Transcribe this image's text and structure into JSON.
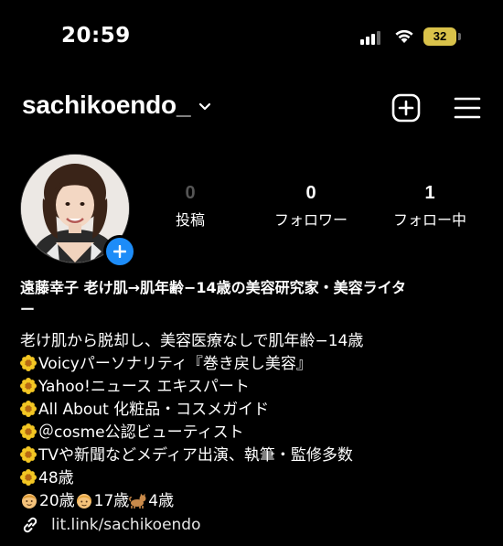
{
  "status_bar": {
    "time": "20:59",
    "battery": "32"
  },
  "header": {
    "username": "sachikoendo_"
  },
  "stats": [
    {
      "value": "0",
      "label": "投稿"
    },
    {
      "value": "0",
      "label": "フォロワー"
    },
    {
      "value": "1",
      "label": "フォロー中"
    }
  ],
  "bio": {
    "name_line1": "遠藤幸子 老け肌→肌年齢−14歳の美容研究家・美容ライタ",
    "name_line2": "ー",
    "line1": "老け肌から脱却し、美容医療なしで肌年齢−14歳",
    "line2": "Voicyパーソナリティ『巻き戻し美容』",
    "line3": "Yahoo!ニュース エキスパート",
    "line4": "All About 化粧品・コスメガイド",
    "line5": "＠cosme公認ビューティスト",
    "line6": "TVや新聞などメディア出演、執筆・監修多数",
    "line7": "48歳",
    "family_1": "20歳",
    "family_2": "17歳",
    "family_3": "4歳"
  },
  "link": {
    "text": "lit.link/sachikoendo"
  },
  "colors": {
    "accent": "#1d8cf8",
    "battery": "#d9c24a",
    "background": "#000000"
  },
  "icons": [
    "signal-icon",
    "wifi-icon",
    "battery-icon",
    "chevron-down-icon",
    "new-post-icon",
    "menu-icon",
    "add-story-icon",
    "sunflower-icon",
    "boy-emoji-icon",
    "girl-emoji-icon",
    "cat-emoji-icon",
    "link-icon"
  ]
}
